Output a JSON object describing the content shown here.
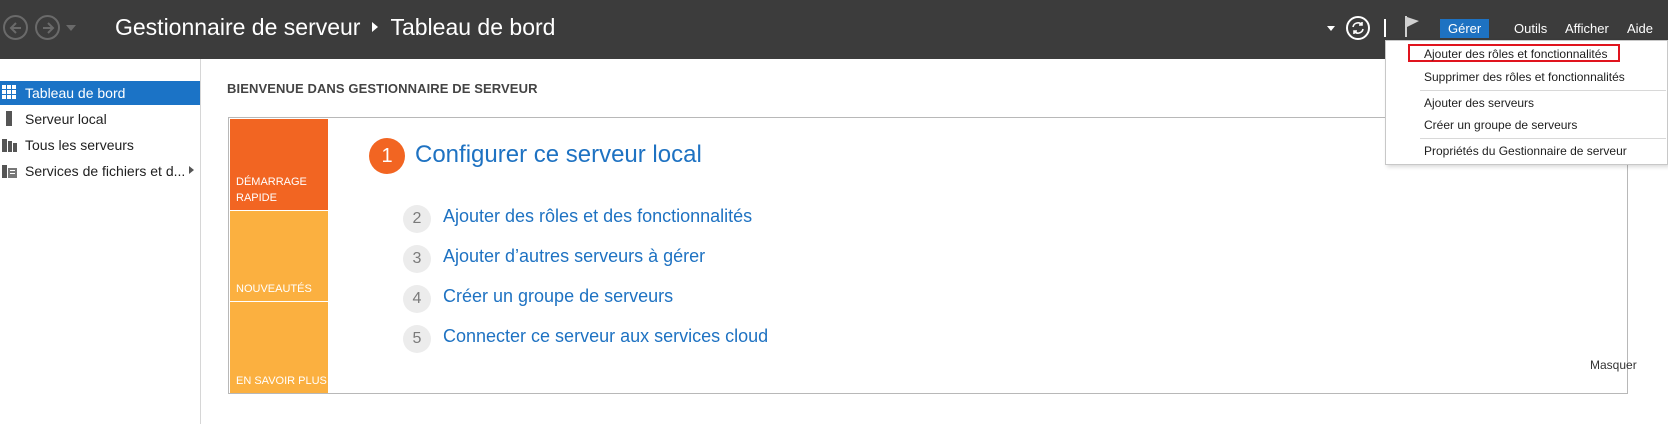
{
  "header": {
    "app_title": "Gestionnaire de serveur",
    "page_title": "Tableau de bord",
    "menu": [
      "Gérer",
      "Outils",
      "Afficher",
      "Aide"
    ]
  },
  "sidebar": {
    "items": [
      {
        "label": "Tableau de bord",
        "icon": "dashboard-icon"
      },
      {
        "label": "Serveur local",
        "icon": "server-icon"
      },
      {
        "label": "Tous les serveurs",
        "icon": "servers-icon"
      },
      {
        "label": "Services de fichiers et d...",
        "icon": "file-services-icon"
      }
    ]
  },
  "main": {
    "welcome": "BIENVENUE DANS GESTIONNAIRE DE SERVEUR",
    "tiles": [
      "DÉMARRAGE RAPIDE",
      "NOUVEAUTÉS",
      "EN SAVOIR PLUS"
    ],
    "steps": [
      {
        "num": "1",
        "text": "Configurer ce serveur local"
      },
      {
        "num": "2",
        "text": "Ajouter des rôles et des fonctionnalités"
      },
      {
        "num": "3",
        "text": "Ajouter d’autres serveurs à gérer"
      },
      {
        "num": "4",
        "text": "Créer un groupe de serveurs"
      },
      {
        "num": "5",
        "text": "Connecter ce serveur aux services cloud"
      }
    ],
    "hide_label": "Masquer"
  },
  "dropdown": {
    "items": [
      "Ajouter des rôles et fonctionnalités",
      "Supprimer des rôles et fonctionnalités",
      "Ajouter des serveurs",
      "Créer un groupe de serveurs",
      "Propriétés du Gestionnaire de serveur"
    ]
  },
  "colors": {
    "header_bg": "#3c3c3c",
    "accent_blue": "#1e72c2",
    "orange": "#f26522",
    "light_orange": "#fbb040",
    "highlight_red": "#e0141e"
  }
}
